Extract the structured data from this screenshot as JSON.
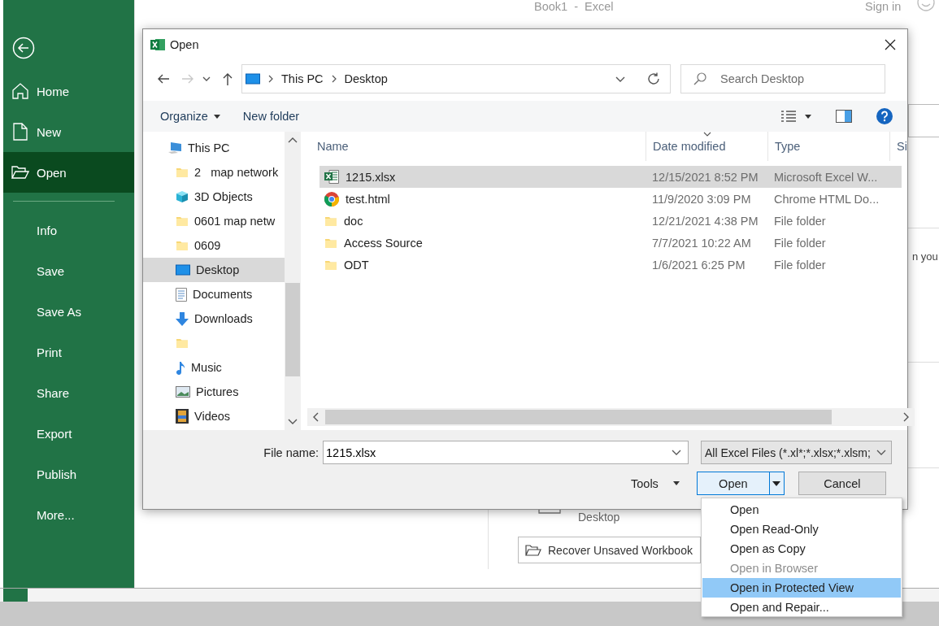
{
  "app": {
    "title": "Book1  -  Excel",
    "sign_in": "Sign in"
  },
  "backstage": {
    "items": [
      {
        "label": "Home",
        "kind": "home",
        "selected": false
      },
      {
        "label": "New",
        "kind": "new",
        "selected": false
      },
      {
        "label": "Open",
        "kind": "open",
        "selected": true
      },
      {
        "label": "Info",
        "kind": "plain",
        "selected": false
      },
      {
        "label": "Save",
        "kind": "plain",
        "selected": false
      },
      {
        "label": "Save As",
        "kind": "plain",
        "selected": false
      },
      {
        "label": "Print",
        "kind": "plain",
        "selected": false
      },
      {
        "label": "Share",
        "kind": "plain",
        "selected": false
      },
      {
        "label": "Export",
        "kind": "plain",
        "selected": false
      },
      {
        "label": "Publish",
        "kind": "plain",
        "selected": false
      },
      {
        "label": "More...",
        "kind": "plain",
        "selected": false
      }
    ]
  },
  "background": {
    "text_fragment": "n you",
    "location": "Desktop",
    "recover_button": "Recover Unsaved Workbook"
  },
  "dialog": {
    "title": "Open",
    "breadcrumb": [
      "This PC",
      "Desktop"
    ],
    "search_placeholder": "Search Desktop",
    "toolbar": {
      "organize": "Organize",
      "new_folder": "New folder"
    },
    "tree": [
      {
        "label": "This PC",
        "kind": "pc",
        "selected": false,
        "children": [
          {
            "label": "2   map network",
            "kind": "folder",
            "selected": false
          },
          {
            "label": "3D Objects",
            "kind": "cube",
            "selected": false
          },
          {
            "label": "0601 map netw",
            "kind": "folder",
            "selected": false
          },
          {
            "label": "0609",
            "kind": "folder",
            "selected": false
          },
          {
            "label": "Desktop",
            "kind": "desktop",
            "selected": true
          },
          {
            "label": "Documents",
            "kind": "documents",
            "selected": false
          },
          {
            "label": "Downloads",
            "kind": "downloads",
            "selected": false
          },
          {
            "kind": "folder",
            "selected": false
          },
          {
            "label": "Music",
            "kind": "music",
            "selected": false
          },
          {
            "label": "Pictures",
            "kind": "pictures",
            "selected": false
          },
          {
            "label": "Videos",
            "kind": "videos",
            "selected": false
          }
        ]
      }
    ],
    "columns": [
      {
        "label": "Name",
        "sorted": false
      },
      {
        "label": "Date modified",
        "sorted": true
      },
      {
        "label": "Type",
        "sorted": false
      },
      {
        "label": "Si",
        "sorted": false
      }
    ],
    "rows": [
      {
        "name": "1215.xlsx",
        "kind": "excel",
        "date": "12/15/2021 8:52 PM",
        "type": "Microsoft Excel W...",
        "selected": true
      },
      {
        "name": "test.html",
        "kind": "chrome",
        "date": "11/9/2020 3:09 PM",
        "type": "Chrome HTML Do...",
        "selected": false
      },
      {
        "name": "doc",
        "kind": "folder",
        "date": "12/21/2021 4:38 PM",
        "type": "File folder",
        "selected": false
      },
      {
        "name": "Access Source",
        "kind": "folder",
        "date": "7/7/2021 10:22 AM",
        "type": "File folder",
        "selected": false
      },
      {
        "name": "ODT",
        "kind": "folder",
        "date": "1/6/2021 6:25 PM",
        "type": "File folder",
        "selected": false
      }
    ],
    "file_name_label": "File name:",
    "file_name": "1215.xlsx",
    "filter": "All Excel Files (*.xl*;*.xlsx;*.xlsm;",
    "tools": "Tools",
    "open": "Open",
    "cancel": "Cancel"
  },
  "open_menu": [
    {
      "label": "Open",
      "disabled": false,
      "selected": false
    },
    {
      "label": "Open Read-Only",
      "disabled": false,
      "selected": false
    },
    {
      "label": "Open as Copy",
      "disabled": false,
      "selected": false
    },
    {
      "label": "Open in Browser",
      "disabled": true,
      "selected": false
    },
    {
      "label": "Open in Protected View",
      "disabled": false,
      "selected": true
    },
    {
      "label": "Open and Repair...",
      "disabled": false,
      "selected": false
    }
  ]
}
